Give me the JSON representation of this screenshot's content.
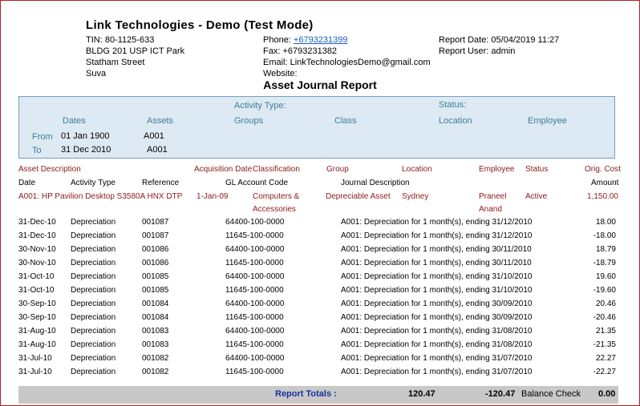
{
  "company": {
    "name": "Link Technologies - Demo (Test Mode)",
    "tin": "TIN: 80-1125-633",
    "address1": "BLDG 201 USP ICT Park",
    "address2": "Statham Street",
    "city": "Suva",
    "phone_label": "Phone: ",
    "phone": "+6793231399",
    "fax": "Fax: +6793231382",
    "email": "Email: LinkTechnologiesDemo@gmail.com",
    "website": "Website:",
    "report_date": "Report Date: 05/04/2019 11:27",
    "report_user": "Report User: admin"
  },
  "report_title": "Asset Journal Report",
  "filter": {
    "activity_type": "Activity Type:",
    "status": "Status:",
    "dates": "Dates",
    "assets": "Assets",
    "groups": "Groups",
    "class": "Class",
    "location": "Location",
    "employee": "Employee",
    "from_label": "From",
    "to_label": "To",
    "from_date": "01 Jan 1900",
    "to_date": "31 Dec 2010",
    "from_asset": "A001",
    "to_asset": "A001"
  },
  "headers": {
    "asset_description": "Asset Description",
    "acquisition_date": "Acquisition Date",
    "classification": "Classification",
    "group": "Group",
    "location": "Location",
    "employee": "Employee",
    "status": "Status",
    "orig_cost": "Orig. Cost",
    "date": "Date",
    "activity_type": "Activity Type",
    "reference": "Reference",
    "gl_account": "GL Account Code",
    "journal_description": "Journal Description",
    "amount": "Amount"
  },
  "asset": {
    "description": "A001: HP Pavilion Desktop S3580A HNX DTP",
    "acquisition_date": "1-Jan-09",
    "classification_1": "Computers &",
    "classification_2": "Accessories",
    "group": "Depreciable Asset",
    "location": "Sydney",
    "employee_1": "Praneel",
    "employee_2": "Anand",
    "status": "Active",
    "orig_cost": "1,150.00"
  },
  "rows": [
    {
      "date": "31-Dec-10",
      "type": "Depreciation",
      "ref": "001087",
      "gl": "64400-100-0000",
      "desc": "A001: Depreciation for 1 month(s), ending 31/12/2010",
      "amount": "18.00"
    },
    {
      "date": "31-Dec-10",
      "type": "Depreciation",
      "ref": "001087",
      "gl": "11645-100-0000",
      "desc": "A001: Depreciation for 1 month(s), ending 31/12/2010",
      "amount": "-18.00"
    },
    {
      "date": "30-Nov-10",
      "type": "Depreciation",
      "ref": "001086",
      "gl": "64400-100-0000",
      "desc": "A001: Depreciation for 1 month(s), ending 30/11/2010",
      "amount": "18.79"
    },
    {
      "date": "30-Nov-10",
      "type": "Depreciation",
      "ref": "001086",
      "gl": "11645-100-0000",
      "desc": "A001: Depreciation for 1 month(s), ending 30/11/2010",
      "amount": "-18.79"
    },
    {
      "date": "31-Oct-10",
      "type": "Depreciation",
      "ref": "001085",
      "gl": "64400-100-0000",
      "desc": "A001: Depreciation for 1 month(s), ending 31/10/2010",
      "amount": "19.60"
    },
    {
      "date": "31-Oct-10",
      "type": "Depreciation",
      "ref": "001085",
      "gl": "11645-100-0000",
      "desc": "A001: Depreciation for 1 month(s), ending 31/10/2010",
      "amount": "-19.60"
    },
    {
      "date": "30-Sep-10",
      "type": "Depreciation",
      "ref": "001084",
      "gl": "64400-100-0000",
      "desc": "A001: Depreciation for 1 month(s), ending 30/09/2010",
      "amount": "20.46"
    },
    {
      "date": "30-Sep-10",
      "type": "Depreciation",
      "ref": "001084",
      "gl": "11645-100-0000",
      "desc": "A001: Depreciation for 1 month(s), ending 30/09/2010",
      "amount": "-20.46"
    },
    {
      "date": "31-Aug-10",
      "type": "Depreciation",
      "ref": "001083",
      "gl": "64400-100-0000",
      "desc": "A001: Depreciation for 1 month(s), ending 31/08/2010",
      "amount": "21.35"
    },
    {
      "date": "31-Aug-10",
      "type": "Depreciation",
      "ref": "001083",
      "gl": "11645-100-0000",
      "desc": "A001: Depreciation for 1 month(s), ending 31/08/2010",
      "amount": "-21.35"
    },
    {
      "date": "31-Jul-10",
      "type": "Depreciation",
      "ref": "001082",
      "gl": "64400-100-0000",
      "desc": "A001: Depreciation for 1 month(s), ending 31/07/2010",
      "amount": "22.27"
    },
    {
      "date": "31-Jul-10",
      "type": "Depreciation",
      "ref": "001082",
      "gl": "11645-100-0000",
      "desc": "A001: Depreciation for 1 month(s), ending 31/07/2010",
      "amount": "-22.27"
    }
  ],
  "totals": {
    "label": "Report Totals :",
    "debit": "120.47",
    "credit": "-120.47",
    "balance_label": "Balance Check",
    "balance": "0.00"
  },
  "colors": {
    "border": "#b22222",
    "filter_bg": "#dde9f3",
    "filter_label": "#3b7f9a",
    "header_red": "#8b1a1a",
    "totals_bg": "#c8c8c8",
    "totals_label": "#1a2f9a"
  }
}
